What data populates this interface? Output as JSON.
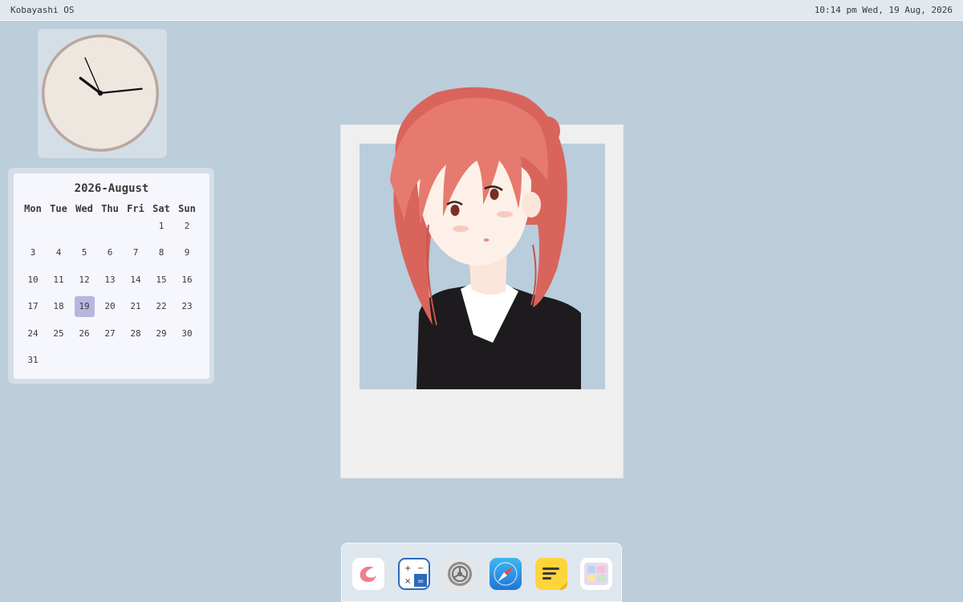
{
  "topbar": {
    "os_name": "Kobayashi OS",
    "datetime": "10:14 pm Wed, 19 Aug, 2026"
  },
  "clock": {
    "hours": 10,
    "minutes": 14
  },
  "calendar": {
    "title": "2026-August",
    "weekdays": [
      "Mon",
      "Tue",
      "Wed",
      "Thu",
      "Fri",
      "Sat",
      "Sun"
    ],
    "weeks": [
      [
        "",
        "",
        "",
        "",
        "",
        "1",
        "2"
      ],
      [
        "3",
        "4",
        "5",
        "6",
        "7",
        "8",
        "9"
      ],
      [
        "10",
        "11",
        "12",
        "13",
        "14",
        "15",
        "16"
      ],
      [
        "17",
        "18",
        "19",
        "20",
        "21",
        "22",
        "23"
      ],
      [
        "24",
        "25",
        "26",
        "27",
        "28",
        "29",
        "30"
      ],
      [
        "31",
        "",
        "",
        "",
        "",
        "",
        ""
      ]
    ],
    "today": "19"
  },
  "dock": {
    "apps": [
      {
        "name": "app-launcher-icon"
      },
      {
        "name": "calculator-icon"
      },
      {
        "name": "settings-icon"
      },
      {
        "name": "safari-compass-icon"
      },
      {
        "name": "notes-icon"
      },
      {
        "name": "gallery-icon"
      }
    ]
  },
  "colors": {
    "desktop_bg": "#bccddb",
    "calendar_today": "#b9b5de",
    "hair": "#e07368"
  }
}
